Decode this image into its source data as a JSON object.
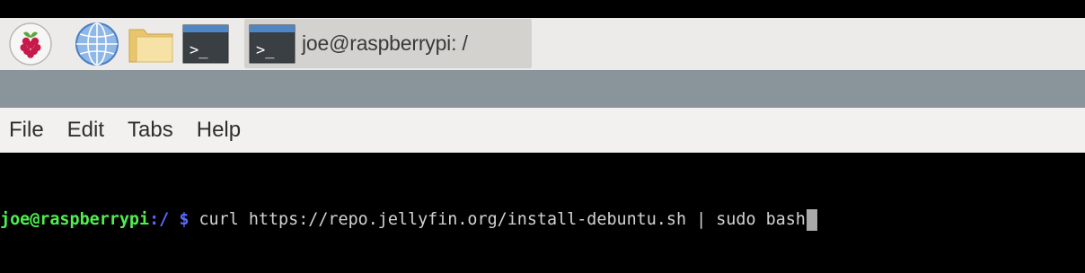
{
  "taskbar": {
    "launchers": [
      {
        "icon": "raspberry-pi-menu-icon"
      },
      {
        "icon": "web-browser-globe-icon"
      },
      {
        "icon": "file-manager-folder-icon"
      },
      {
        "icon": "terminal-launcher-icon",
        "glyph": ">_"
      }
    ],
    "active_task": {
      "icon": "terminal-task-icon",
      "glyph": ">_",
      "label": "joe@raspberrypi: /"
    }
  },
  "menubar": {
    "items": [
      "File",
      "Edit",
      "Tabs",
      "Help"
    ]
  },
  "terminal": {
    "prompt_user": "joe@raspberrypi",
    "prompt_path": ":/",
    "prompt_sign": "$",
    "command": "curl https://repo.jellyfin.org/install-debuntu.sh | sudo bash"
  },
  "colors": {
    "taskbar_bg": "#ecebea",
    "active_task_bg": "#d4d2cf",
    "band": "#8a949b",
    "menubar_bg": "#f2f1f0",
    "terminal_bg": "#000000",
    "prompt_user": "#4ef04e",
    "prompt_path": "#5a6cff"
  }
}
